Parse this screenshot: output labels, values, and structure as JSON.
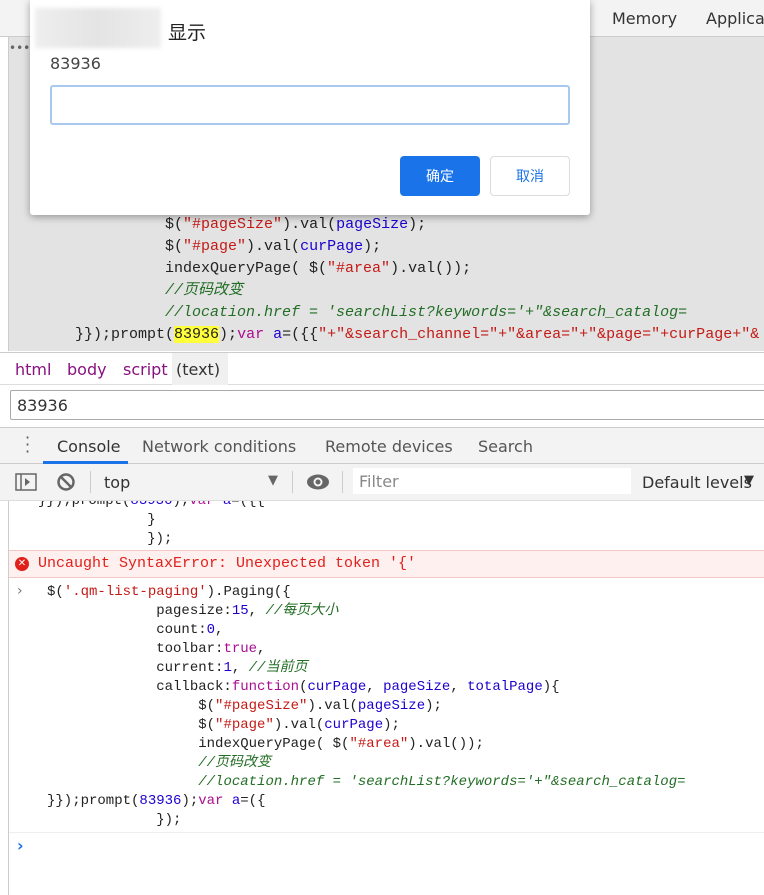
{
  "top_tabs": [
    "Memory",
    "Applicat"
  ],
  "source_lines": [
    {
      "indent": "                 ",
      "tokens": [
        [
          "p",
          "){"
        ]
      ]
    },
    {
      "indent": "          ",
      "tokens": [
        [
          "",
          "$("
        ],
        [
          "s",
          "\"#pageSize\""
        ],
        [
          "",
          ").val("
        ],
        [
          "v",
          "pageSize"
        ],
        [
          "",
          ");"
        ]
      ]
    },
    {
      "indent": "          ",
      "tokens": [
        [
          "",
          "$("
        ],
        [
          "s",
          "\"#page\""
        ],
        [
          "",
          ").val("
        ],
        [
          "v",
          "curPage"
        ],
        [
          "",
          ");"
        ]
      ]
    },
    {
      "indent": "          ",
      "tokens": [
        [
          "",
          "indexQueryPage( $("
        ],
        [
          "s",
          "\"#area\""
        ],
        [
          "",
          ").val());"
        ]
      ]
    },
    {
      "indent": "          ",
      "tokens": [
        [
          "c",
          "//页码改变"
        ]
      ]
    },
    {
      "indent": "          ",
      "tokens": [
        [
          "c",
          "//location.href = 'searchList?keywords='+\"&search_catalog="
        ]
      ]
    },
    {
      "indent": "",
      "tokens": [
        [
          "",
          "}});prompt("
        ],
        [
          "hl",
          "83936"
        ],
        [
          "",
          ");"
        ],
        [
          "k",
          "var"
        ],
        [
          "",
          " "
        ],
        [
          "v",
          "a"
        ],
        [
          "",
          "=({{"
        ],
        [
          "s",
          "\"+\"&search_channel=\"+\"&area=\"+\"&page=\"+curPage+\"&"
        ]
      ]
    }
  ],
  "dialog": {
    "title": "显示",
    "message": "83936",
    "input_value": "",
    "ok_label": "确定",
    "cancel_label": "取消"
  },
  "breadcrumbs": [
    "html",
    "body",
    "script",
    "(text)"
  ],
  "value_input": "83936",
  "drawer_tabs": [
    "Console",
    "Network conditions",
    "Remote devices",
    "Search"
  ],
  "toolbar": {
    "context": "top",
    "filter_placeholder": "Filter",
    "levels": "Default levels"
  },
  "console_lines_before": [
    {
      "indent": "",
      "tokens": [
        [
          "",
          "}});prompt("
        ],
        [
          "v",
          "83936"
        ],
        [
          "",
          ");"
        ],
        [
          "k",
          "var"
        ],
        [
          "",
          " "
        ],
        [
          "v",
          "a"
        ],
        [
          "",
          "=({{"
        ]
      ]
    },
    {
      "indent": "             ",
      "tokens": [
        [
          "",
          "}"
        ]
      ]
    },
    {
      "indent": "             ",
      "tokens": [
        [
          "",
          "});"
        ]
      ]
    }
  ],
  "error": {
    "message": "Uncaught SyntaxError: Unexpected token '{'"
  },
  "console_input_lines": [
    {
      "indent": "",
      "tokens": [
        [
          "",
          "$("
        ],
        [
          "s",
          "'.qm-list-paging'"
        ],
        [
          "",
          ").Paging({"
        ]
      ]
    },
    {
      "indent": "             ",
      "tokens": [
        [
          "",
          "pagesize:"
        ],
        [
          "n",
          "15"
        ],
        [
          "",
          ", "
        ],
        [
          "c",
          "//每页大小"
        ]
      ]
    },
    {
      "indent": "             ",
      "tokens": [
        [
          "",
          "count:"
        ],
        [
          "n",
          "0"
        ],
        [
          "",
          ","
        ]
      ]
    },
    {
      "indent": "             ",
      "tokens": [
        [
          "",
          "toolbar:"
        ],
        [
          "k",
          "true"
        ],
        [
          "",
          ","
        ]
      ]
    },
    {
      "indent": "             ",
      "tokens": [
        [
          "",
          "current:"
        ],
        [
          "n",
          "1"
        ],
        [
          "",
          ", "
        ],
        [
          "c",
          "//当前页"
        ]
      ]
    },
    {
      "indent": "             ",
      "tokens": [
        [
          "",
          "callback:"
        ],
        [
          "k",
          "function"
        ],
        [
          "",
          "("
        ],
        [
          "v",
          "curPage"
        ],
        [
          "",
          ", "
        ],
        [
          "v",
          "pageSize"
        ],
        [
          "",
          ", "
        ],
        [
          "v",
          "totalPage"
        ],
        [
          "",
          "){"
        ]
      ]
    },
    {
      "indent": "                  ",
      "tokens": [
        [
          "",
          "$("
        ],
        [
          "s",
          "\"#pageSize\""
        ],
        [
          "",
          ").val("
        ],
        [
          "v",
          "pageSize"
        ],
        [
          "",
          ");"
        ]
      ]
    },
    {
      "indent": "                  ",
      "tokens": [
        [
          "",
          "$("
        ],
        [
          "s",
          "\"#page\""
        ],
        [
          "",
          ").val("
        ],
        [
          "v",
          "curPage"
        ],
        [
          "",
          ");"
        ]
      ]
    },
    {
      "indent": "                  ",
      "tokens": [
        [
          "",
          "indexQueryPage( $("
        ],
        [
          "s",
          "\"#area\""
        ],
        [
          "",
          ").val());"
        ]
      ]
    },
    {
      "indent": "                  ",
      "tokens": [
        [
          "c",
          "//页码改变"
        ]
      ]
    },
    {
      "indent": "                  ",
      "tokens": [
        [
          "c",
          "//location.href = 'searchList?keywords='+\"&search_catalog="
        ]
      ]
    },
    {
      "indent": "",
      "tokens": [
        [
          "",
          "}});prompt("
        ],
        [
          "v",
          "83936"
        ],
        [
          "",
          ");"
        ],
        [
          "k",
          "var"
        ],
        [
          "",
          " "
        ],
        [
          "v",
          "a"
        ],
        [
          "",
          "=({"
        ]
      ]
    },
    {
      "indent": "             ",
      "tokens": [
        [
          "",
          "});"
        ]
      ]
    }
  ],
  "colors": {
    "accent": "#1a73e8",
    "error": "#e0201a",
    "highlight": "#ffff3c"
  }
}
